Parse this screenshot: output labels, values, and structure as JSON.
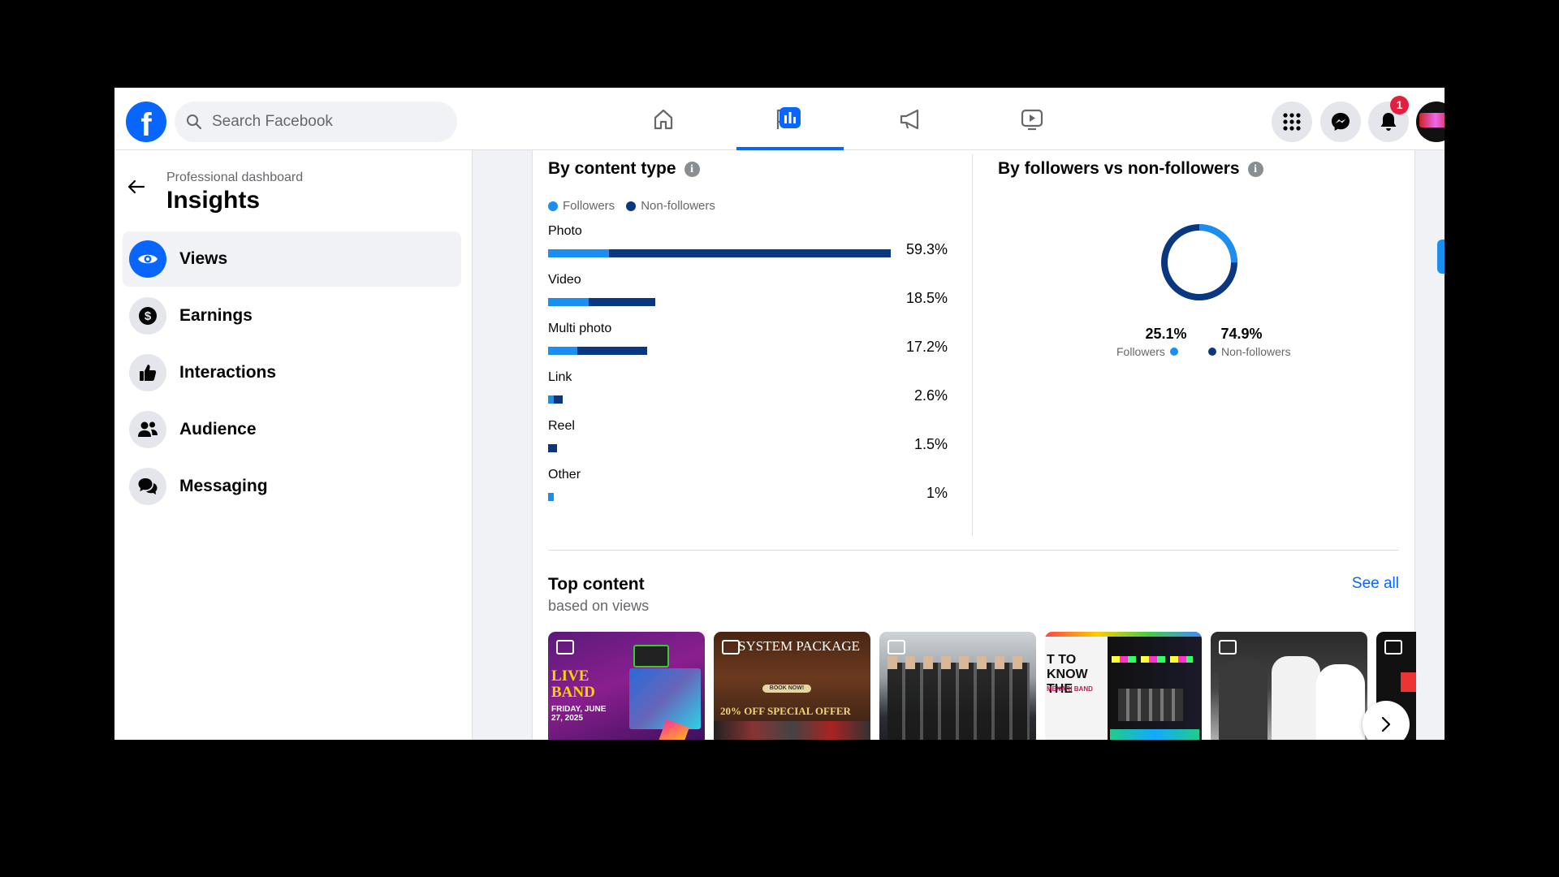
{
  "header": {
    "search_placeholder": "Search Facebook",
    "notification_count": "1",
    "accent_color": "#0866ff"
  },
  "sidebar": {
    "breadcrumb": "Professional dashboard",
    "title": "Insights",
    "items": [
      {
        "label": "Views",
        "icon": "eye-icon",
        "active": true
      },
      {
        "label": "Earnings",
        "icon": "dollar-icon"
      },
      {
        "label": "Interactions",
        "icon": "thumbs-up-icon"
      },
      {
        "label": "Audience",
        "icon": "people-icon"
      },
      {
        "label": "Messaging",
        "icon": "chat-icon"
      }
    ]
  },
  "content_type": {
    "title": "By content type",
    "legend": {
      "followers": "Followers",
      "non_followers": "Non-followers"
    },
    "colors": {
      "followers": "#1b8ef2",
      "non_followers": "#0a3880"
    },
    "rows": [
      {
        "label": "Photo",
        "pct": "59.3%"
      },
      {
        "label": "Video",
        "pct": "18.5%"
      },
      {
        "label": "Multi photo",
        "pct": "17.2%"
      },
      {
        "label": "Link",
        "pct": "2.6%"
      },
      {
        "label": "Reel",
        "pct": "1.5%"
      },
      {
        "label": "Other",
        "pct": "1%"
      }
    ]
  },
  "followers_split": {
    "title": "By followers vs non-followers",
    "followers_value": "25.1%",
    "followers_label": "Followers",
    "non_followers_value": "74.9%",
    "non_followers_label": "Non-followers"
  },
  "top_content": {
    "title": "Top content",
    "subtitle": "based on views",
    "see_all": "See all",
    "thumbs": [
      {
        "text": "LIVE BAND",
        "sub": "FRIDAY, JUNE 27, 2025"
      },
      {
        "text": "SYSTEM PACKAGE",
        "sub": "20% OFF SPECIAL OFFER",
        "button": "BOOK NOW!"
      },
      {
        "text": ""
      },
      {
        "text": "T TO KNOW THE",
        "sub": "MENARI BAND"
      },
      {
        "text": ""
      },
      {
        "text": ""
      }
    ]
  },
  "chart_data": [
    {
      "type": "bar",
      "title": "By content type",
      "categories": [
        "Photo",
        "Video",
        "Multi photo",
        "Link",
        "Reel",
        "Other"
      ],
      "values": [
        59.3,
        18.5,
        17.2,
        2.6,
        1.5,
        1
      ],
      "series": [
        {
          "name": "Followers",
          "values": [
            10.5,
            7.0,
            5.0,
            1.0,
            0.0,
            1.0
          ]
        },
        {
          "name": "Non-followers",
          "values": [
            48.8,
            11.5,
            12.2,
            1.6,
            1.5,
            0.0
          ]
        }
      ]
    },
    {
      "type": "pie",
      "title": "By followers vs non-followers",
      "categories": [
        "Followers",
        "Non-followers"
      ],
      "values": [
        25.1,
        74.9
      ]
    }
  ]
}
